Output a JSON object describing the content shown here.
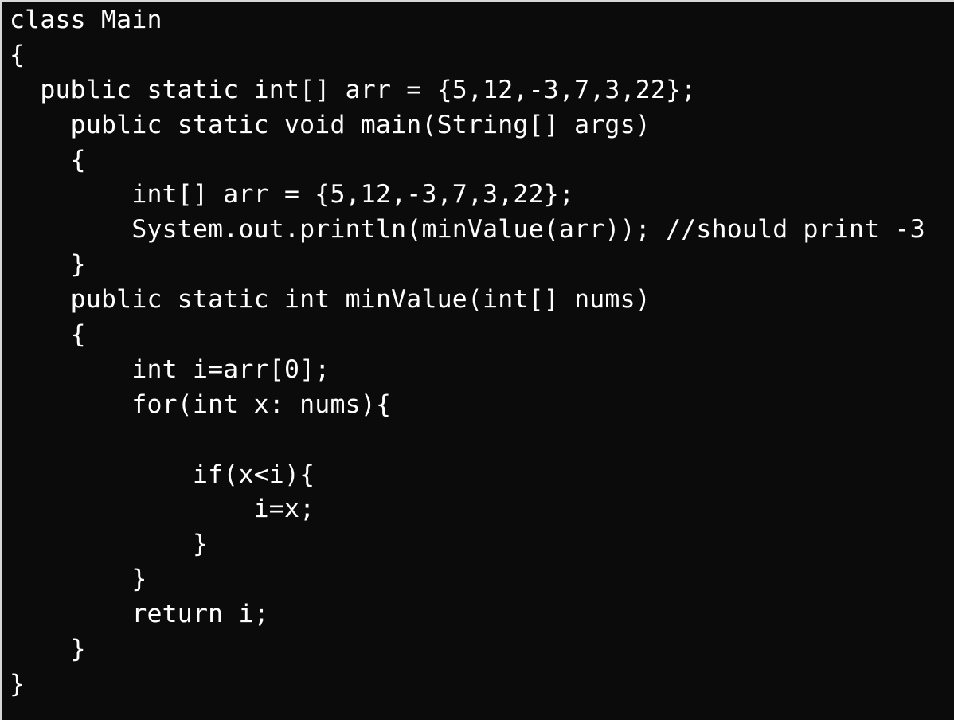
{
  "editor": {
    "lines": [
      "class Main",
      "{",
      "  public static int[] arr = {5,12,-3,7,3,22};",
      "    public static void main(String[] args)",
      "    {",
      "        int[] arr = {5,12,-3,7,3,22};",
      "        System.out.println(minValue(arr)); //should print -3",
      "    }",
      "    public static int minValue(int[] nums)",
      "    {",
      "        int i=arr[0];",
      "        for(int x: nums){",
      "",
      "            if(x<i){",
      "                i=x;",
      "            }",
      "        }",
      "        return i;",
      "    }",
      "}"
    ]
  }
}
